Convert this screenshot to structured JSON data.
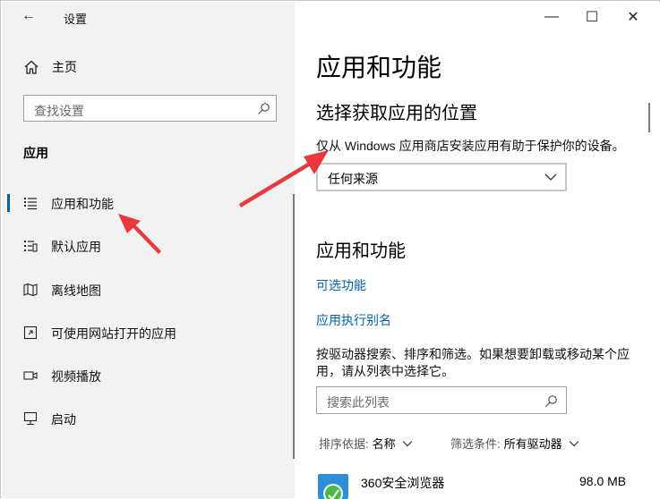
{
  "window": {
    "title": "设置",
    "controls": {
      "minimize": "—",
      "maximize": "☐",
      "close": "✕"
    }
  },
  "sidebar": {
    "home_label": "主页",
    "search_placeholder": "查找设置",
    "section_title": "应用",
    "items": [
      {
        "label": "应用和功能",
        "icon": "apps-features-icon",
        "selected": true
      },
      {
        "label": "默认应用",
        "icon": "default-apps-icon"
      },
      {
        "label": "离线地图",
        "icon": "offline-maps-icon"
      },
      {
        "label": "可使用网站打开的应用",
        "icon": "apps-for-websites-icon"
      },
      {
        "label": "视频播放",
        "icon": "video-playback-icon"
      },
      {
        "label": "启动",
        "icon": "startup-icon"
      }
    ]
  },
  "main": {
    "page_title": "应用和功能",
    "choose_section": {
      "heading": "选择获取应用的位置",
      "description": "仅从 Windows 应用商店安装应用有助于保护你的设备。",
      "dropdown_value": "任何来源"
    },
    "apps_section": {
      "heading": "应用和功能",
      "link_optional": "可选功能",
      "link_aliases": "应用执行别名",
      "description": "按驱动器搜索、排序和筛选。如果想要卸载或移动某个应用，请从列表中选择它。",
      "search_placeholder": "搜索此列表",
      "sort_label": "排序依据:",
      "sort_value": "名称",
      "filter_label": "筛选条件:",
      "filter_value": "所有驱动器"
    },
    "apps": [
      {
        "name": "360安全浏览器",
        "size": "98.0 MB"
      }
    ]
  },
  "colors": {
    "accent": "#0063b1",
    "annotation_arrow": "#e8383d",
    "sidebar_bg": "#f2f2f2"
  }
}
